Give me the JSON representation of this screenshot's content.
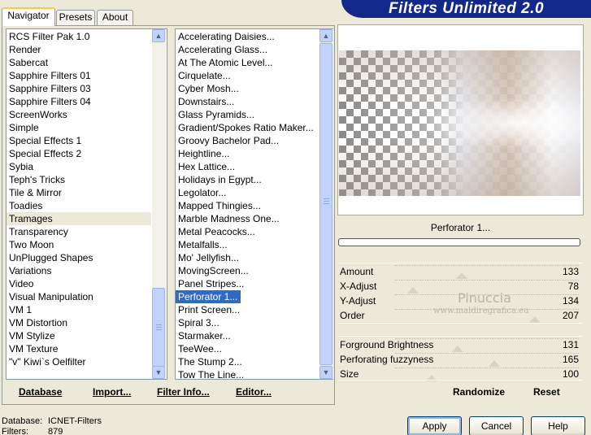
{
  "tabs": [
    {
      "label": "Navigator"
    },
    {
      "label": "Presets"
    },
    {
      "label": "About"
    }
  ],
  "banner": {
    "title": "Filters Unlimited 2.0"
  },
  "categories": [
    {
      "label": "RCS Filter Pak 1.0"
    },
    {
      "label": "Render"
    },
    {
      "label": "Sabercat"
    },
    {
      "label": "Sapphire Filters 01"
    },
    {
      "label": "Sapphire Filters 03"
    },
    {
      "label": "Sapphire Filters 04"
    },
    {
      "label": "ScreenWorks"
    },
    {
      "label": "Simple"
    },
    {
      "label": "Special Effects 1"
    },
    {
      "label": "Special Effects 2"
    },
    {
      "label": "Sybia"
    },
    {
      "label": "Teph's Tricks"
    },
    {
      "label": "Tile & Mirror"
    },
    {
      "label": "Toadies"
    },
    {
      "label": "Tramages"
    },
    {
      "label": "Transparency"
    },
    {
      "label": "Two Moon"
    },
    {
      "label": "UnPlugged Shapes"
    },
    {
      "label": "Variations"
    },
    {
      "label": "Video"
    },
    {
      "label": "Visual Manipulation"
    },
    {
      "label": "VM 1"
    },
    {
      "label": "VM Distortion"
    },
    {
      "label": "VM Stylize"
    },
    {
      "label": "VM Texture"
    },
    {
      "label": "\"v\" Kiwi`s Oelfilter"
    }
  ],
  "selected_category": "Tramages",
  "filters": [
    {
      "label": "Accelerating Daisies..."
    },
    {
      "label": "Accelerating Glass..."
    },
    {
      "label": "At The Atomic Level..."
    },
    {
      "label": "Cirquelate..."
    },
    {
      "label": "Cyber Mosh..."
    },
    {
      "label": "Downstairs..."
    },
    {
      "label": "Glass Pyramids..."
    },
    {
      "label": "Gradient/Spokes Ratio Maker..."
    },
    {
      "label": "Groovy Bachelor Pad..."
    },
    {
      "label": "Heightline..."
    },
    {
      "label": "Hex Lattice..."
    },
    {
      "label": "Holidays in Egypt..."
    },
    {
      "label": "Legolator..."
    },
    {
      "label": "Mapped Thingies..."
    },
    {
      "label": "Marble Madness One..."
    },
    {
      "label": "Metal Peacocks..."
    },
    {
      "label": "Metalfalls..."
    },
    {
      "label": "Mo' Jellyfish..."
    },
    {
      "label": "MovingScreen..."
    },
    {
      "label": "Panel Stripes..."
    },
    {
      "label": "Perforator 1..."
    },
    {
      "label": "Print Screen..."
    },
    {
      "label": "Spiral 3..."
    },
    {
      "label": "Starmaker..."
    },
    {
      "label": "TeeWee..."
    },
    {
      "label": "The Stump 2..."
    },
    {
      "label": "Tow The Line..."
    }
  ],
  "selected_filter": "Perforator 1...",
  "bottom_buttons": {
    "database": "Database",
    "import": "Import...",
    "filter_info": "Filter Info...",
    "editor": "Editor..."
  },
  "filter_name": "Perforator 1...",
  "params": [
    {
      "label": "Amount",
      "value": "133"
    },
    {
      "label": "X-Adjust",
      "value": "78"
    },
    {
      "label": "Y-Adjust",
      "value": "134"
    },
    {
      "label": "Order",
      "value": "207"
    },
    {
      "label": "Forground Brightness",
      "value": "131"
    },
    {
      "label": "Perforating fuzzyness",
      "value": "165"
    },
    {
      "label": "Size",
      "value": "100"
    }
  ],
  "watermark": {
    "name": "Pinuccia",
    "site": "www.maldiregrafica.eu"
  },
  "actions": {
    "randomize": "Randomize",
    "reset": "Reset"
  },
  "status": {
    "database_label": "Database:",
    "database_value": "ICNET-Filters",
    "filters_label": "Filters:",
    "filters_value": "879"
  },
  "dialog_buttons": {
    "apply": "Apply",
    "cancel": "Cancel",
    "help": "Help"
  },
  "colors": {
    "selection": "#316ac5",
    "banner": "#12288a",
    "face": "#ece9d8"
  }
}
